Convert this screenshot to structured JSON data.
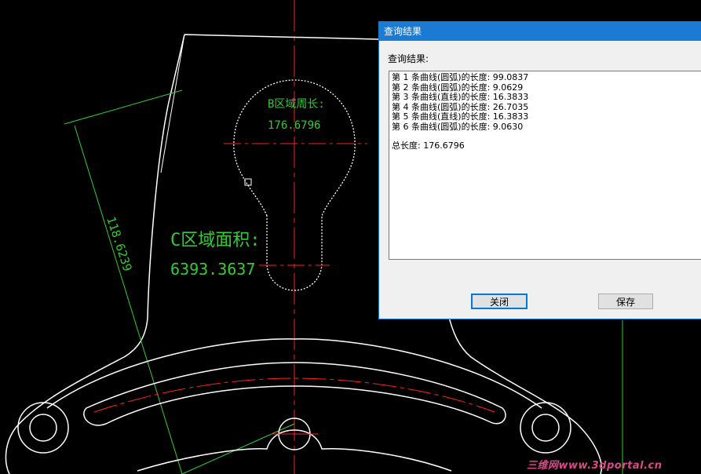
{
  "drawing": {
    "b_label": "B区域周长:",
    "b_value": "176.6796",
    "c_label": "C区域面积:",
    "c_value": "6393.3637",
    "dimension": "118.6239"
  },
  "dialog": {
    "title": "查询结果",
    "result_label": "查询结果:",
    "lines": [
      "第 1 条曲线(圆弧)的长度: 99.0837",
      "第 2 条曲线(圆弧)的长度: 9.0629",
      "第 3 条曲线(直线)的长度: 16.3833",
      "第 4 条曲线(圆弧)的长度: 26.7035",
      "第 5 条曲线(直线)的长度: 16.3833",
      "第 6 条曲线(圆弧)的长度: 9.0630"
    ],
    "total": "总长度: 176.6796",
    "close_label": "关闭",
    "save_label": "保存"
  },
  "watermark": "三维网www.3dportal.cn",
  "colors": {
    "background": "#000000",
    "outline": "#ffffff",
    "centerline": "#ff2020",
    "dimension": "#33cc33",
    "titlebar": "#1a7ad4"
  }
}
